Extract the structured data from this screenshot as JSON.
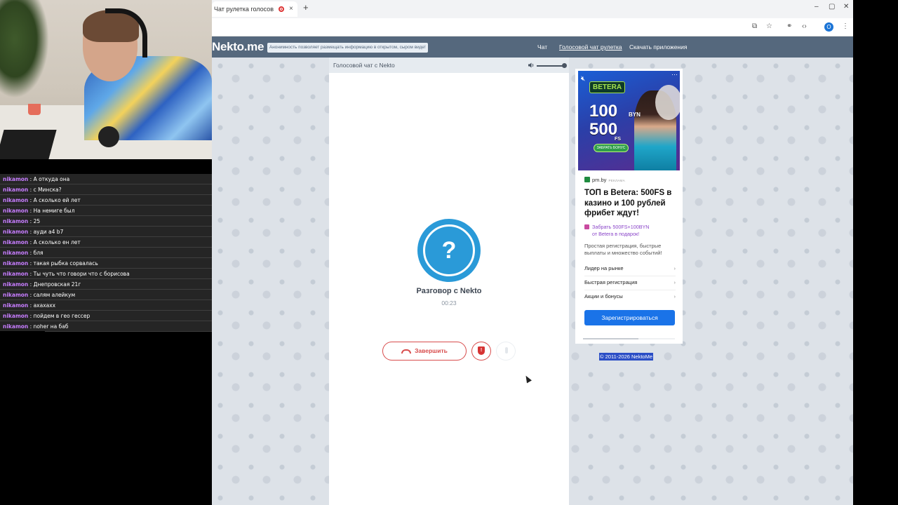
{
  "browser": {
    "tab_title": "Чат рулетка голосов",
    "new_tab": "+",
    "tab_close": "×",
    "win_min": "–",
    "win_max": "▢",
    "win_close": "✕",
    "profile_initial": "О"
  },
  "site": {
    "logo": "Nekto.me",
    "notice": "Анонимность позволяет размещать информацию в открытом, сыром виде!",
    "nav": [
      {
        "label": "Чат"
      },
      {
        "label": "Голосовой чат рулетка",
        "active": true
      },
      {
        "label": "Скачать приложения"
      }
    ]
  },
  "panel": {
    "title": "Голосовой чат с Nekto",
    "avatar_symbol": "?",
    "partner_label": "Разговор с Nekto",
    "timer": "00:23",
    "end_button": "Завершить",
    "report_symbol": "!",
    "volume_level": 1.0
  },
  "ad": {
    "banner": {
      "brand": "BETERA",
      "amount1": "100",
      "currency": "BYN",
      "amount2": "500",
      "unit": "FS",
      "cta": "ЗАБРАТЬ БОНУС"
    },
    "source": "pm.by",
    "source_label": "РЕКЛАМА",
    "title": "ТОП в Betera: 500FS в казино и 100 рублей фрибет ждут!",
    "promo_line1": "Забрать 500FS+100BYN",
    "promo_line2": "от Betera в подарок!",
    "description": "Простая регистрация, быстрые выплаты и множество событий!",
    "items": [
      "Лидер на рынке",
      "Быстрая регистрация",
      "Акции и бонусы"
    ],
    "cta": "Зарегистрироваться",
    "progress": 0.6
  },
  "copyright": "© 2011-2026 NektoMe",
  "stream_chat": [
    {
      "user": "nikamon",
      "text": "А откуда она"
    },
    {
      "user": "nikamon",
      "text": "с Минска?"
    },
    {
      "user": "nikamon",
      "text": "А сколько ей лет"
    },
    {
      "user": "nikamon",
      "text": "На немиге был"
    },
    {
      "user": "nikamon",
      "text": "25"
    },
    {
      "user": "nikamon",
      "text": "ауди а4 b7"
    },
    {
      "user": "nikamon",
      "text": "А сколько ен лет"
    },
    {
      "user": "nikamon",
      "text": "бля"
    },
    {
      "user": "nikamon",
      "text": "такая рыбка сорвалась"
    },
    {
      "user": "nikamon",
      "text": "Ты чуть что говори что с борисова"
    },
    {
      "user": "nikamon",
      "text": "Днепровская 21г"
    },
    {
      "user": "nikamon",
      "text": "салям алейкум"
    },
    {
      "user": "nikamon",
      "text": "ахахахх"
    },
    {
      "user": "nikamon",
      "text": "пойдем в гео гессер"
    },
    {
      "user": "nikamon",
      "text": "noher на баб"
    }
  ]
}
